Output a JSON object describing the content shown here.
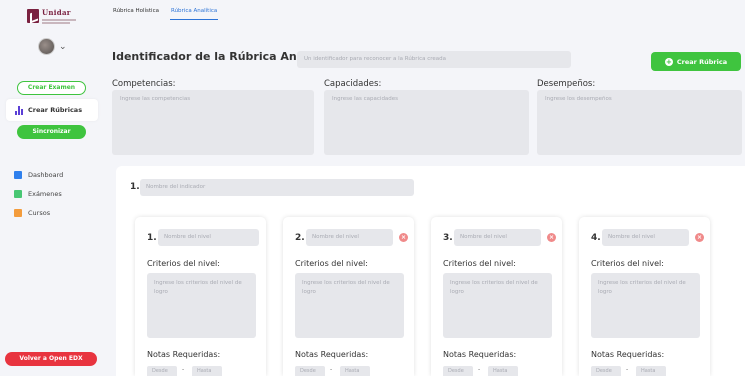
{
  "sidebar": {
    "logo_text": "Unidar",
    "crear_examen": "Crear Examen",
    "crear_rubricas": "Crear Rúbricas",
    "sincronizar": "Sincronizar",
    "links": [
      {
        "label": "Dashboard",
        "color": "#2f80ed"
      },
      {
        "label": "Exámenes",
        "color": "#48c774"
      },
      {
        "label": "Cursos",
        "color": "#f39c3d"
      }
    ],
    "volver": "Volver a Open EDX"
  },
  "tabs": [
    {
      "label": "Rúbrica Holística",
      "active": false
    },
    {
      "label": "Rúbrica Analítica",
      "active": true
    }
  ],
  "header": {
    "ident_label": "Identificador de la Rúbrica Analítica:",
    "ident_placeholder": "Un identificador para reconocer a la Rúbrica creada",
    "create_button": "Crear Rúbrica"
  },
  "sections": {
    "competencias": {
      "label": "Competencias:",
      "placeholder": "Ingrese las competencias"
    },
    "capacidades": {
      "label": "Capacidades:",
      "placeholder": "Ingrese las capacidades"
    },
    "desempenos": {
      "label": "Desempeños:",
      "placeholder": "Ingrese los desempeños"
    }
  },
  "indicator": {
    "number": "1.",
    "placeholder": "Nombre del indicador"
  },
  "levels": [
    {
      "number": "1.",
      "name_placeholder": "Nombre del nivel",
      "criteria_label": "Criterios del nivel:",
      "criteria_placeholder": "Ingrese los criterios del nivel de logro",
      "notas_label": "Notas Requeridas:",
      "desde": "Desde",
      "hasta": "Hasta",
      "deletable": false
    },
    {
      "number": "2.",
      "name_placeholder": "Nombre del nivel",
      "criteria_label": "Criterios del nivel:",
      "criteria_placeholder": "Ingrese los criterios del nivel de logro",
      "notas_label": "Notas Requeridas:",
      "desde": "Desde",
      "hasta": "Hasta",
      "deletable": true
    },
    {
      "number": "3.",
      "name_placeholder": "Nombre del nivel",
      "criteria_label": "Criterios del nivel:",
      "criteria_placeholder": "Ingrese los criterios del nivel de logro",
      "notas_label": "Notas Requeridas:",
      "desde": "Desde",
      "hasta": "Hasta",
      "deletable": true
    },
    {
      "number": "4.",
      "name_placeholder": "Nombre del nivel",
      "criteria_label": "Criterios del nivel:",
      "criteria_placeholder": "Ingrese los criterios del nivel de logro",
      "notas_label": "Notas Requeridas:",
      "desde": "Desde",
      "hasta": "Hasta",
      "deletable": true
    }
  ],
  "level_dash": "-",
  "plus_glyph": "+",
  "delete_glyph": "×",
  "colors": {
    "accent_green": "#3fc43f",
    "danger_red": "#e8343f",
    "tab_blue": "#2c73d6",
    "brand": "#7a2140"
  }
}
